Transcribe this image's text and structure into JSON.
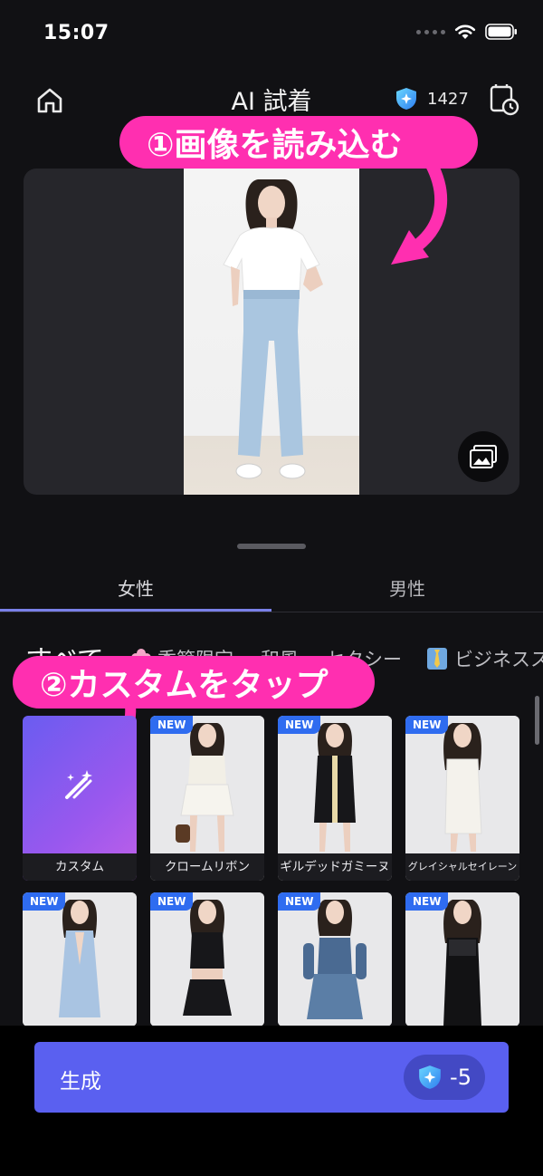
{
  "status_bar": {
    "time": "15:07"
  },
  "header": {
    "title": "AI 試着",
    "credits": "1427"
  },
  "annotations": {
    "step1": "①画像を読み込む",
    "step2": "②カスタムをタップ"
  },
  "gender_tabs": [
    {
      "label": "女性",
      "active": true
    },
    {
      "label": "男性",
      "active": false
    }
  ],
  "categories": [
    {
      "label": "すべて",
      "icon": ""
    },
    {
      "label": "季節限定",
      "icon": "flower-icon"
    },
    {
      "label": "和風",
      "icon": ""
    },
    {
      "label": "セクシー",
      "icon": ""
    },
    {
      "label": "ビジネスス",
      "icon": "necktie-icon"
    }
  ],
  "outfits": [
    {
      "label": "カスタム",
      "badge": ""
    },
    {
      "label": "クロームリボン",
      "badge": "NEW"
    },
    {
      "label": "ギルデッドガミーヌ",
      "badge": "NEW"
    },
    {
      "label": "グレイシャルセイレーン",
      "badge": "NEW"
    },
    {
      "label": "",
      "badge": "NEW"
    },
    {
      "label": "",
      "badge": "NEW"
    },
    {
      "label": "",
      "badge": "NEW"
    },
    {
      "label": "",
      "badge": "NEW"
    }
  ],
  "generate": {
    "label": "生成",
    "cost": "-5"
  },
  "colors": {
    "accent": "#5a60f0",
    "annotation": "#ff2fb0",
    "badge": "#2f6cf0",
    "tab_underline": "#7a80e8"
  }
}
